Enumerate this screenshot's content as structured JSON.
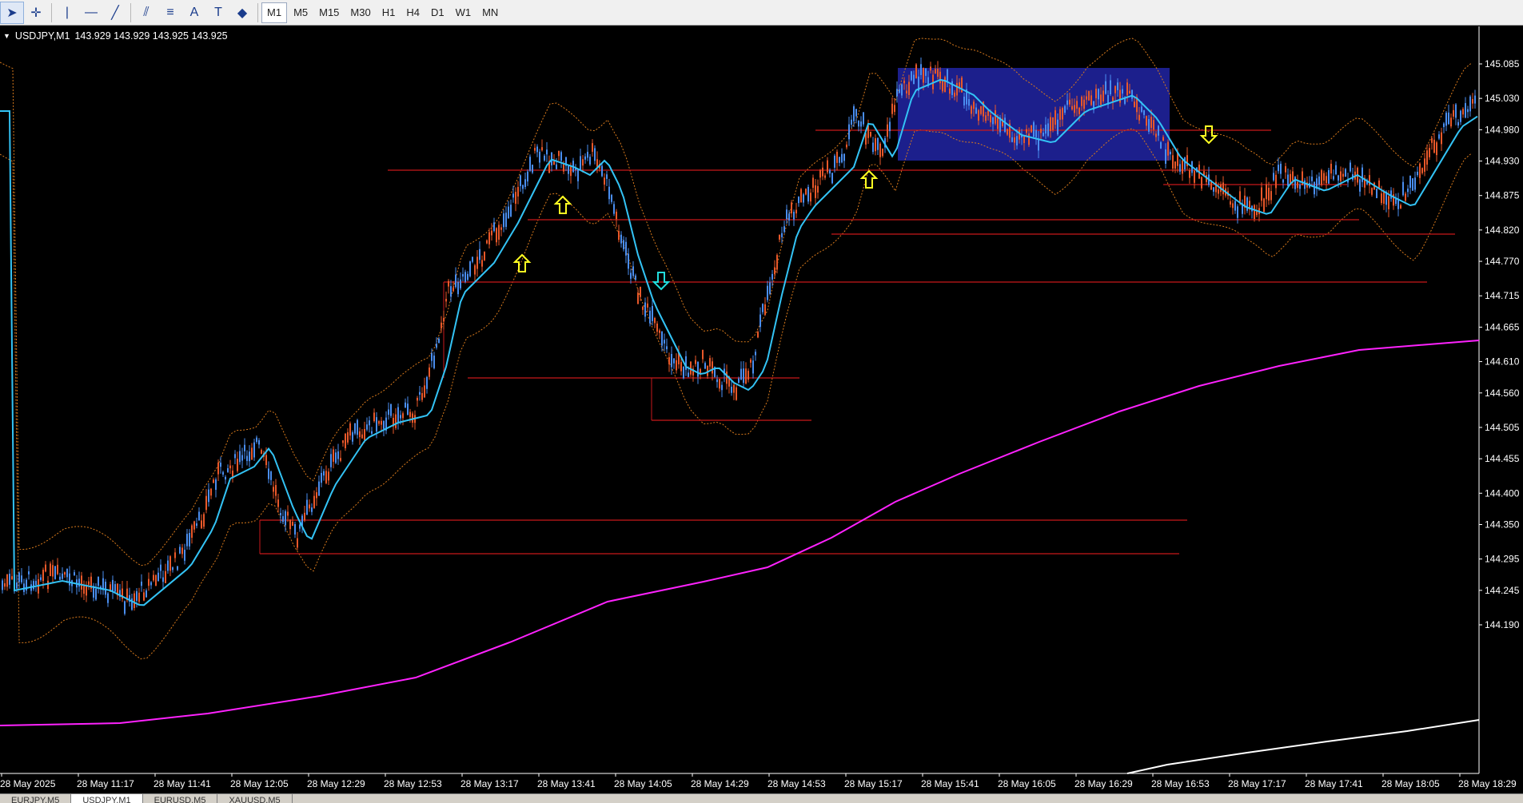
{
  "toolbar": {
    "tools": [
      {
        "name": "cursor-icon",
        "glyph": "➤"
      },
      {
        "name": "crosshair-icon",
        "glyph": "✛"
      },
      {
        "name": "vertical-line-icon",
        "glyph": "|"
      },
      {
        "name": "horizontal-line-icon",
        "glyph": "—"
      },
      {
        "name": "trendline-icon",
        "glyph": "╱"
      },
      {
        "name": "equidistant-channel-icon",
        "glyph": "⫽"
      },
      {
        "name": "fibonacci-icon",
        "glyph": "≡"
      },
      {
        "name": "text-icon",
        "glyph": "A"
      },
      {
        "name": "text-label-icon",
        "glyph": "T"
      },
      {
        "name": "shapes-icon",
        "glyph": "◆"
      }
    ],
    "timeframes": [
      "M1",
      "M5",
      "M15",
      "M30",
      "H1",
      "H4",
      "D1",
      "W1",
      "MN"
    ],
    "active_timeframe": "M1"
  },
  "chart": {
    "header": {
      "symbol": "USDJPY,M1",
      "ohlc": "143.929 143.929 143.925 143.925"
    },
    "price_labels": [
      "145.085",
      "145.030",
      "144.980",
      "144.930",
      "144.875",
      "144.820",
      "144.770",
      "144.715",
      "144.665",
      "144.610",
      "144.560",
      "144.505",
      "144.455",
      "144.400",
      "144.350",
      "144.295",
      "144.245",
      "144.190"
    ],
    "time_labels": [
      "28 May 2025",
      "28 May 11:17",
      "28 May 11:41",
      "28 May 12:05",
      "28 May 12:29",
      "28 May 12:53",
      "28 May 13:17",
      "28 May 13:41",
      "28 May 14:05",
      "28 May 14:29",
      "28 May 14:53",
      "28 May 15:17",
      "28 May 15:41",
      "28 May 16:05",
      "28 May 16:29",
      "28 May 16:53",
      "28 May 17:17",
      "28 May 17:41",
      "28 May 18:05",
      "28 May 18:29"
    ],
    "colors": {
      "bull": "#e8582a",
      "bear": "#4a8ef0",
      "ma_fast": "#33c3f5",
      "ma_slow": "#ff22ff",
      "ma_long": "#ffffff",
      "band": "#d97a1c",
      "levels": "#c8181b",
      "zone": "#1c1f8c",
      "arrow": "#ffff22",
      "arrow_alt": "#22dddd"
    }
  },
  "tabs": [
    "EURJPY,M5",
    "USDJPY,M1",
    "EURUSD,M5",
    "XAUUSD,M5"
  ],
  "active_tab": "USDJPY,M1"
}
